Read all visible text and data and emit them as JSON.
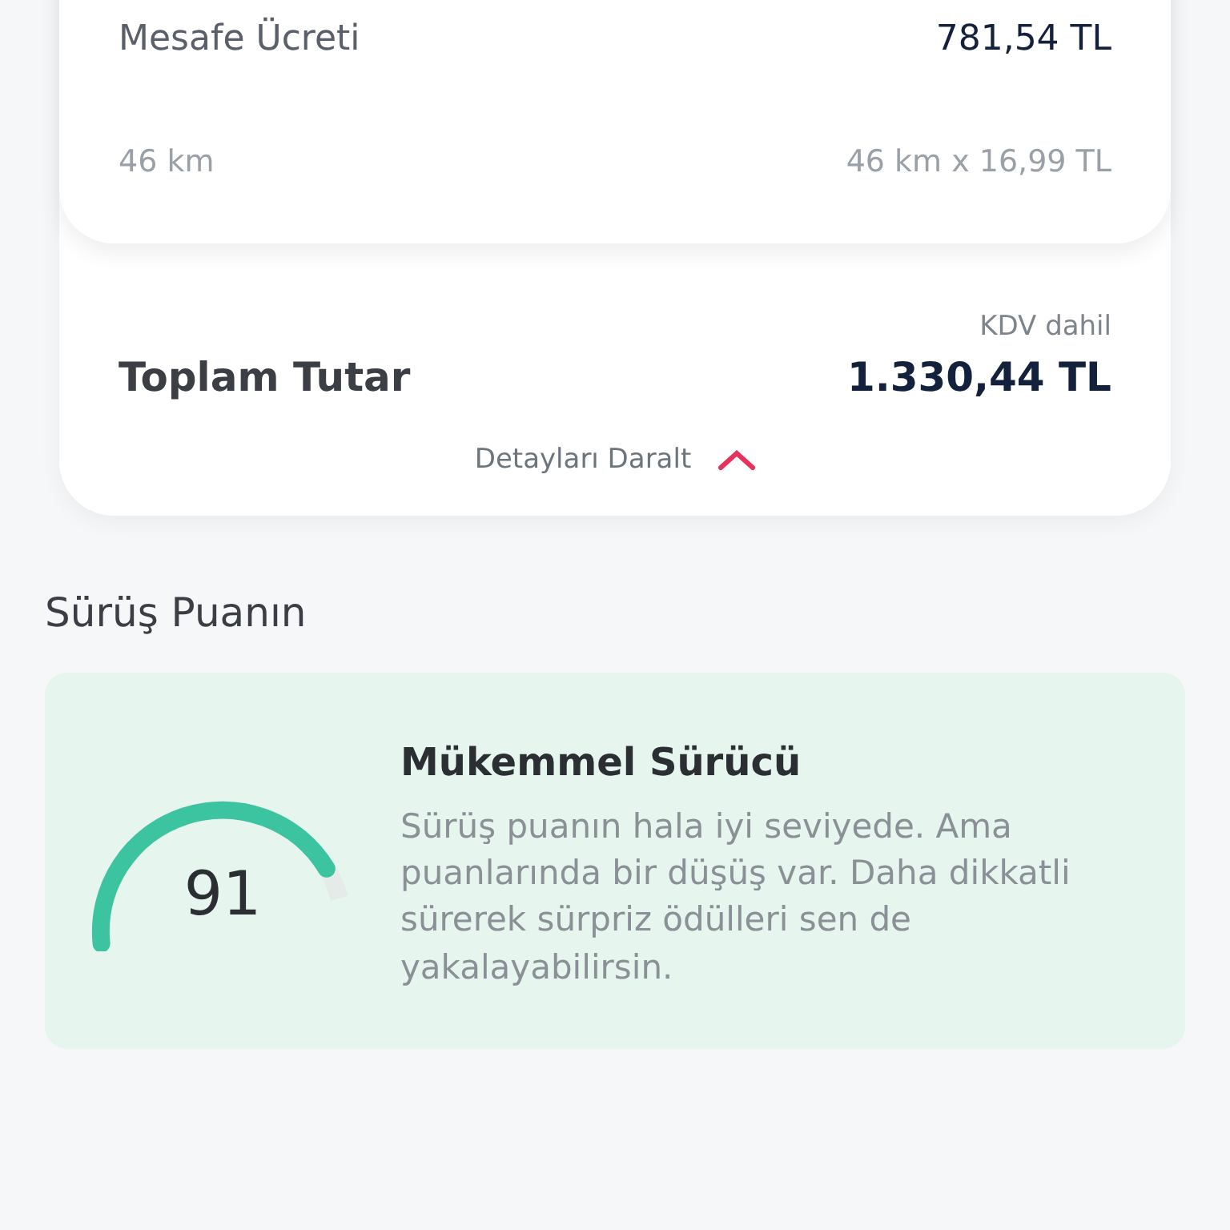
{
  "fare_card": {
    "rows": [
      {
        "label": "Mesafe Ücreti",
        "value": "781,54 TL"
      },
      {
        "label": "46 km",
        "value": "46 km x 16,99 TL"
      }
    ]
  },
  "total": {
    "note": "KDV dahil",
    "label": "Toplam Tutar",
    "value": "1.330,44 TL",
    "toggle": "Detayları Daralt",
    "expanded": true
  },
  "score_section": {
    "title": "Sürüş Puanın",
    "score": "91",
    "level": 0.91,
    "heading": "Mükemmel Sürücü",
    "text": "Sürüş puanın hala iyi seviyede. Ama puanlarında bir düşüş var. Daha dikkatli sürerek sürpriz ödülleri sen de yakalayabilirsin."
  }
}
